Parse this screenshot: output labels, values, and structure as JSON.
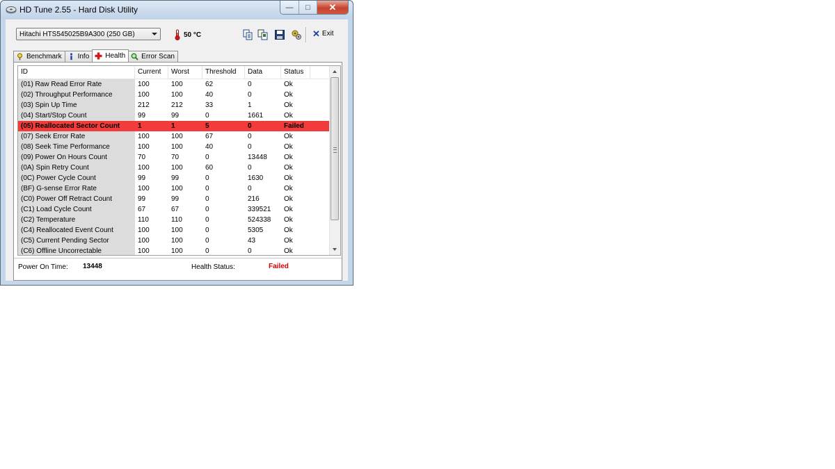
{
  "window": {
    "title": "HD Tune 2.55 - Hard Disk Utility",
    "controls": {
      "minimize": "—",
      "maximize": "□",
      "close": "✕"
    }
  },
  "toolbar": {
    "drive": "Hitachi HTS545025B9A300 (250 GB)",
    "temperature": "50 °C",
    "exit_label": "Exit",
    "tools": [
      "copy-icon",
      "copy-all-icon",
      "save-icon",
      "options-icon"
    ]
  },
  "tabs": [
    {
      "label": "Benchmark",
      "icon": "benchmark-icon",
      "active": false
    },
    {
      "label": "Info",
      "icon": "info-icon",
      "active": false
    },
    {
      "label": "Health",
      "icon": "health-icon",
      "active": true
    },
    {
      "label": "Error Scan",
      "icon": "error-scan-icon",
      "active": false
    }
  ],
  "table": {
    "columns": [
      "ID",
      "Current",
      "Worst",
      "Threshold",
      "Data",
      "Status"
    ],
    "rows": [
      [
        "(01) Raw Read Error Rate",
        "100",
        "100",
        "62",
        "0",
        "Ok"
      ],
      [
        "(02) Throughput Performance",
        "100",
        "100",
        "40",
        "0",
        "Ok"
      ],
      [
        "(03) Spin Up Time",
        "212",
        "212",
        "33",
        "1",
        "Ok"
      ],
      [
        "(04) Start/Stop Count",
        "99",
        "99",
        "0",
        "1661",
        "Ok"
      ],
      [
        "(05) Reallocated Sector Count",
        "1",
        "1",
        "5",
        "0",
        "Failed"
      ],
      [
        "(07) Seek Error Rate",
        "100",
        "100",
        "67",
        "0",
        "Ok"
      ],
      [
        "(08) Seek Time Performance",
        "100",
        "100",
        "40",
        "0",
        "Ok"
      ],
      [
        "(09) Power On Hours Count",
        "70",
        "70",
        "0",
        "13448",
        "Ok"
      ],
      [
        "(0A) Spin Retry Count",
        "100",
        "100",
        "60",
        "0",
        "Ok"
      ],
      [
        "(0C) Power Cycle Count",
        "99",
        "99",
        "0",
        "1630",
        "Ok"
      ],
      [
        "(BF) G-sense Error Rate",
        "100",
        "100",
        "0",
        "0",
        "Ok"
      ],
      [
        "(C0) Power Off Retract Count",
        "99",
        "99",
        "0",
        "216",
        "Ok"
      ],
      [
        "(C1) Load Cycle Count",
        "67",
        "67",
        "0",
        "339521",
        "Ok"
      ],
      [
        "(C2) Temperature",
        "110",
        "110",
        "0",
        "524338",
        "Ok"
      ],
      [
        "(C4) Reallocated Event Count",
        "100",
        "100",
        "0",
        "5305",
        "Ok"
      ],
      [
        "(C5) Current Pending Sector",
        "100",
        "100",
        "0",
        "43",
        "Ok"
      ],
      [
        "(C6) Offline Uncorrectable",
        "100",
        "100",
        "0",
        "0",
        "Ok"
      ]
    ]
  },
  "footer": {
    "power_on_label": "Power On Time:",
    "power_on_value": "13448",
    "health_label": "Health Status:",
    "health_value": "Failed"
  },
  "colors": {
    "failed_row": "#f23b3b",
    "failed_text": "#d40000"
  }
}
